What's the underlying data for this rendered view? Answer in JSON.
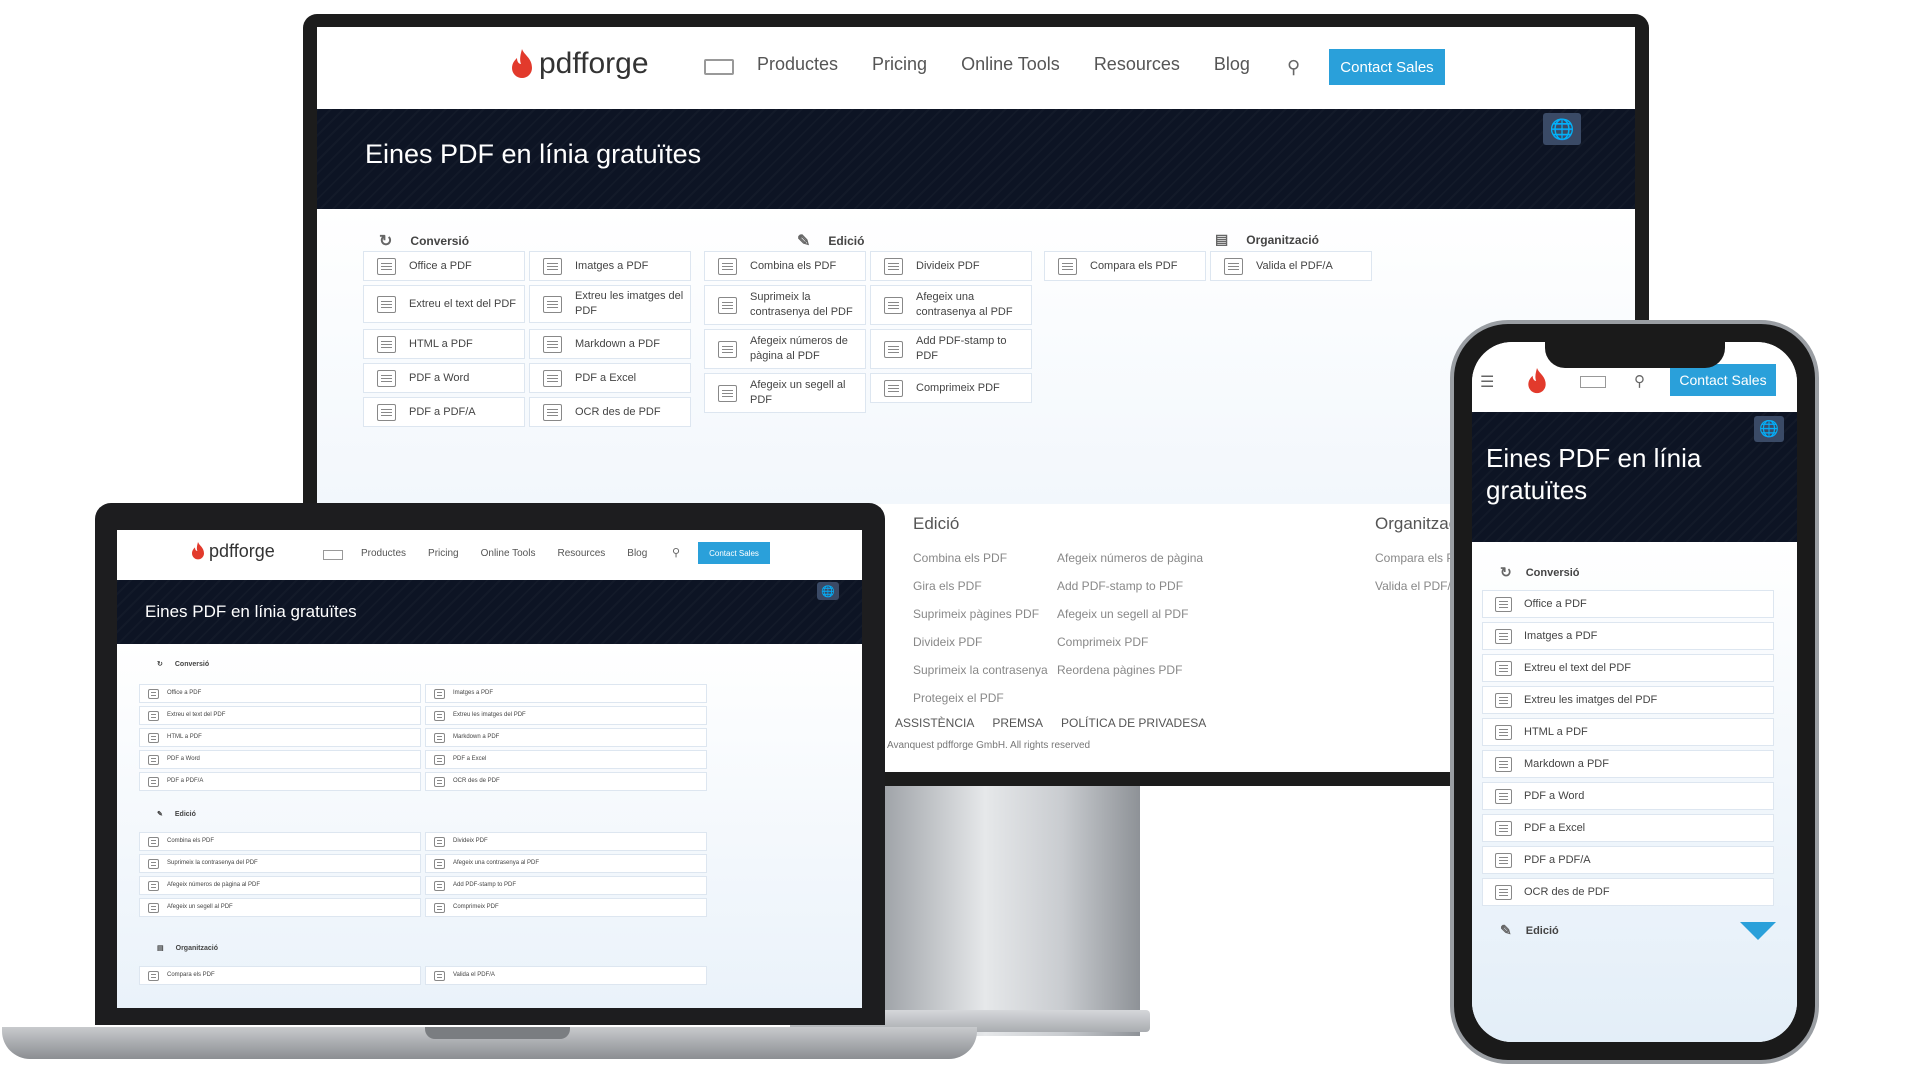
{
  "brand": {
    "name": "pdfforge",
    "accent": "#2aa0da",
    "hero_bg": "#0d1424",
    "flame": "#e23a2c"
  },
  "nav": {
    "items": [
      "Productes",
      "Pricing",
      "Online Tools",
      "Resources",
      "Blog"
    ],
    "contact": "Contact Sales"
  },
  "hero": {
    "title": "Eines PDF en línia gratuïtes"
  },
  "categories": {
    "conversio": {
      "label": "Conversió",
      "tools": [
        "Office a PDF",
        "Imatges a PDF",
        "Extreu el text del PDF",
        "Extreu les imatges del PDF",
        "HTML a PDF",
        "Markdown a PDF",
        "PDF a Word",
        "PDF a Excel",
        "PDF a PDF/A",
        "OCR des de PDF"
      ]
    },
    "edicio": {
      "label": "Edició",
      "tools": [
        "Combina els PDF",
        "Divideix PDF",
        "Suprimeix la contrasenya del PDF",
        "Afegeix una contrasenya al PDF",
        "Afegeix números de pàgina al PDF",
        "Add PDF-stamp to PDF",
        "Afegeix un segell al PDF",
        "Comprimeix PDF"
      ]
    },
    "organitzacio": {
      "label": "Organització",
      "tools": [
        "Compara els PDF",
        "Valida el PDF/A"
      ]
    }
  },
  "footer": {
    "edicio_title": "Edició",
    "edicio_col1": [
      "Combina els PDF",
      "Gira els PDF",
      "Suprimeix pàgines PDF",
      "Divideix PDF",
      "Suprimeix la contrasenya",
      "Protegeix el PDF"
    ],
    "edicio_col2": [
      "Afegeix números de pàgina",
      "Add PDF-stamp to PDF",
      "Afegeix un segell al PDF",
      "Comprimeix PDF",
      "Reordena pàgines PDF"
    ],
    "organ_title": "Organitzac",
    "organ_col": [
      "Compara els P",
      "Valida el PDF/"
    ],
    "links": [
      "ASSISTÈNCIA",
      "PREMSA",
      "POLÍTICA DE PRIVADESA"
    ],
    "copyright": "Avanquest pdfforge GmbH. All rights reserved"
  },
  "phone": {
    "hero_title_line1": "Eines PDF en línia",
    "hero_title_line2": "gratuïtes"
  }
}
